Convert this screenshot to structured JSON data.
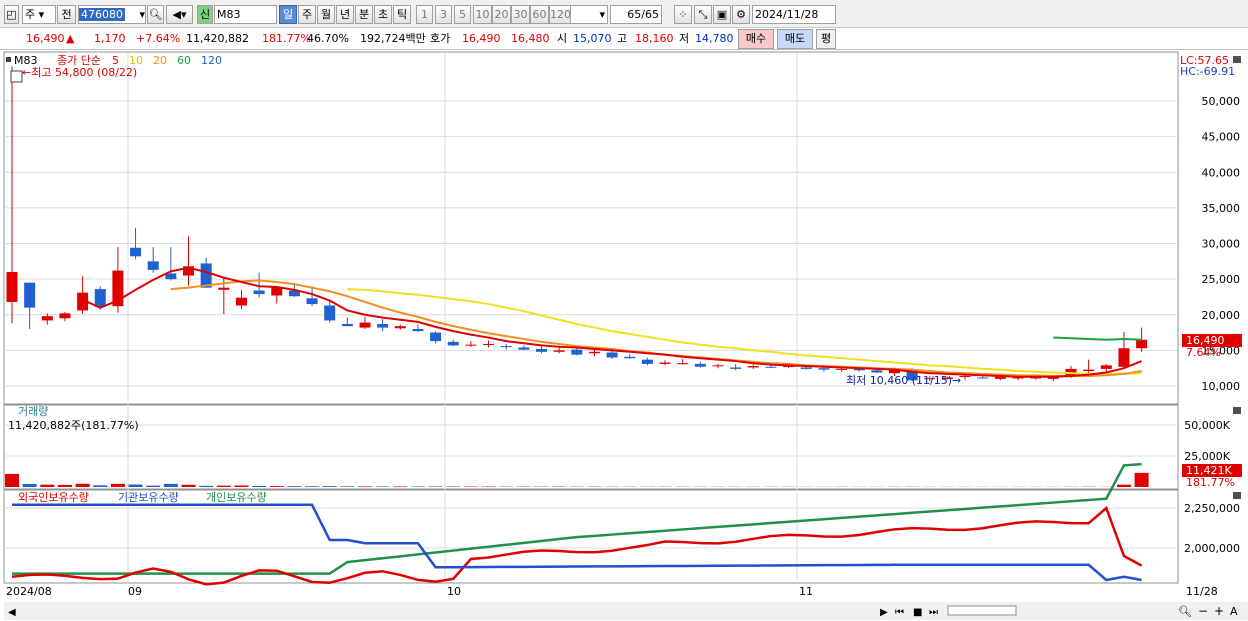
{
  "toolbar": {
    "period": "주",
    "prev": "전",
    "code": "476080",
    "badge": "신",
    "stock_name": "M83",
    "tabs": [
      "일",
      "주",
      "월",
      "년",
      "분",
      "초",
      "틱"
    ],
    "active_tab": "일",
    "minutes": [
      "1",
      "3",
      "5",
      "10",
      "20",
      "30",
      "60",
      "120"
    ],
    "count": "65",
    "total": "/65",
    "date": "2024/11/28"
  },
  "quote": {
    "price": "16,490",
    "arrow": "▲",
    "change": "1,170",
    "change_pct": "+7.64%",
    "volume": "11,420,882",
    "vol_ratio": "181.77%",
    "turnover": "46.70%",
    "amount": "192,724백만",
    "ask_label": "호가",
    "ask": "16,490",
    "bid": "16,480",
    "open_label": "시",
    "open": "15,070",
    "high_label": "고",
    "high": "18,160",
    "low_label": "저",
    "low": "14,780",
    "buy": "매수",
    "sell": "매도",
    "eval": "평"
  },
  "price_panel": {
    "name": "M83",
    "ma_label": "종가 단순",
    "ma_periods": [
      "5",
      "10",
      "20",
      "60",
      "120"
    ],
    "ma_colors": [
      "#e00000",
      "#e0c000",
      "#f09020",
      "#20a040",
      "#2060c0"
    ],
    "high_annot": "←최고 54,800 (08/22)",
    "low_annot": "최저 10,460 (11/15)→",
    "lc": "LC:57.65",
    "hc": "HC:-69.91",
    "last_price": "16,490",
    "last_pct": "7.64%",
    "yticks": [
      "50,000",
      "45,000",
      "40,000",
      "35,000",
      "30,000",
      "25,000",
      "20,000",
      "15,000",
      "10,000"
    ]
  },
  "volume_panel": {
    "title": "거래량",
    "value": "11,420,882주(181.77%)",
    "yticks": [
      "50,000K",
      "25,000K"
    ],
    "last": "11,421K",
    "last_pct": "181.77%"
  },
  "holdings_panel": {
    "foreign": "외국인보유수량",
    "inst": "기관보유수량",
    "indiv": "개인보유수량",
    "yticks": [
      "2,250,000",
      "2,000,000"
    ]
  },
  "xaxis": {
    "labels": [
      "2024/08",
      "09",
      "10",
      "11"
    ],
    "end": "11/28"
  },
  "colors": {
    "up": "#e00000",
    "down": "#2060d0"
  },
  "chart_data": {
    "type": "candlestick",
    "dates_note": "2024/08/22 - 2024/11/28, 65 trading days",
    "ohlc": [
      [
        21800,
        54800,
        18800,
        26000
      ],
      [
        24500,
        24500,
        18000,
        21000
      ],
      [
        19200,
        20200,
        18600,
        19800
      ],
      [
        19500,
        20400,
        19100,
        20200
      ],
      [
        20600,
        25400,
        20100,
        23100
      ],
      [
        23600,
        24000,
        20700,
        21100
      ],
      [
        21200,
        29500,
        20300,
        26200
      ],
      [
        29400,
        32200,
        27800,
        28200
      ],
      [
        27500,
        29500,
        25900,
        26300
      ],
      [
        25800,
        29500,
        24800,
        25000
      ],
      [
        25500,
        31000,
        24100,
        26800
      ],
      [
        27200,
        28000,
        23800,
        23800
      ],
      [
        23500,
        25200,
        20100,
        23800
      ],
      [
        21300,
        23500,
        20800,
        22400
      ],
      [
        23400,
        25900,
        22400,
        22900
      ],
      [
        22700,
        24000,
        21600,
        23900
      ],
      [
        23400,
        24500,
        22500,
        22600
      ],
      [
        22300,
        24000,
        21200,
        21500
      ],
      [
        21300,
        22000,
        18900,
        19200
      ],
      [
        18700,
        19600,
        18400,
        18400
      ],
      [
        18200,
        19700,
        18000,
        18900
      ],
      [
        18700,
        19400,
        17700,
        18200
      ],
      [
        18100,
        18600,
        17900,
        18400
      ],
      [
        18000,
        18600,
        17600,
        17700
      ],
      [
        17500,
        17700,
        16000,
        16300
      ],
      [
        16200,
        16500,
        15600,
        15700
      ],
      [
        15700,
        16300,
        15500,
        15800
      ],
      [
        15800,
        16400,
        15400,
        15900
      ],
      [
        15600,
        15900,
        15100,
        15500
      ],
      [
        15400,
        15700,
        15000,
        15100
      ],
      [
        15200,
        15600,
        14600,
        14800
      ],
      [
        14800,
        15400,
        14600,
        15000
      ],
      [
        15100,
        15500,
        14300,
        14400
      ],
      [
        14600,
        15100,
        14200,
        14800
      ],
      [
        14700,
        14900,
        13800,
        14000
      ],
      [
        14100,
        14500,
        13800,
        13900
      ],
      [
        13700,
        14000,
        12900,
        13100
      ],
      [
        13100,
        13600,
        12900,
        13300
      ],
      [
        13200,
        13800,
        13000,
        13200
      ],
      [
        13100,
        13400,
        12600,
        12700
      ],
      [
        12800,
        13100,
        12500,
        12900
      ],
      [
        12600,
        13100,
        12200,
        12400
      ],
      [
        12600,
        13000,
        12400,
        12800
      ],
      [
        12700,
        13000,
        12500,
        12600
      ],
      [
        12700,
        12900,
        12500,
        12800
      ],
      [
        12600,
        12900,
        12300,
        12400
      ],
      [
        12500,
        13000,
        12000,
        12300
      ],
      [
        12300,
        12800,
        12000,
        12400
      ],
      [
        12400,
        12700,
        12000,
        12200
      ],
      [
        12200,
        12400,
        11800,
        11900
      ],
      [
        11800,
        12600,
        11400,
        12500
      ],
      [
        12300,
        12500,
        10700,
        10800
      ],
      [
        11000,
        11400,
        10700,
        11100
      ],
      [
        11000,
        11300,
        10900,
        11200
      ],
      [
        11300,
        11700,
        10900,
        11400
      ],
      [
        11200,
        11500,
        11000,
        11100
      ],
      [
        11000,
        11400,
        10800,
        11300
      ],
      [
        11100,
        11400,
        10800,
        11200
      ],
      [
        11200,
        11500,
        10900,
        11200
      ],
      [
        11000,
        11400,
        10700,
        11300
      ],
      [
        11300,
        12800,
        11100,
        12400
      ],
      [
        12100,
        13700,
        11500,
        12300
      ],
      [
        12400,
        13100,
        11900,
        12900
      ],
      [
        12700,
        17600,
        12600,
        15300
      ],
      [
        15300,
        18200,
        14800,
        16490
      ]
    ],
    "volume_k": [
      10500,
      2400,
      1900,
      1700,
      2600,
      1300,
      2600,
      2000,
      1100,
      2500,
      1800,
      900,
      1100,
      1200,
      800,
      700,
      650,
      600,
      700,
      500,
      450,
      400,
      420,
      380,
      450,
      380,
      350,
      330,
      300,
      320,
      280,
      300,
      260,
      240,
      220,
      210,
      200,
      190,
      190,
      180,
      170,
      170,
      160,
      160,
      150,
      150,
      150,
      140,
      140,
      140,
      150,
      200,
      130,
      120,
      110,
      110,
      100,
      110,
      100,
      100,
      150,
      210,
      120,
      1900,
      11421
    ],
    "ma5": [
      null,
      null,
      null,
      null,
      22100,
      21000,
      22000,
      23500,
      24900,
      26100,
      26600,
      26000,
      25200,
      24600,
      24000,
      23900,
      23500,
      22900,
      22000,
      20600,
      20000,
      19600,
      19300,
      19000,
      18300,
      17700,
      17200,
      16800,
      16300,
      16000,
      15700,
      15500,
      15400,
      15200,
      15000,
      14800,
      14600,
      14400,
      14100,
      13900,
      13700,
      13500,
      13200,
      13000,
      12900,
      12800,
      12700,
      12600,
      12500,
      12400,
      12300,
      12000,
      11800,
      11700,
      11600,
      11500,
      11400,
      11300,
      11300,
      11300,
      11400,
      11600,
      11900,
      12500,
      13500
    ],
    "ma10": [
      null,
      null,
      null,
      null,
      null,
      null,
      null,
      null,
      null,
      23600,
      23800,
      24100,
      24400,
      24700,
      24800,
      24600,
      24300,
      23800,
      23300,
      22600,
      21800,
      21000,
      20300,
      19700,
      19000,
      18400,
      17900,
      17400,
      17000,
      16600,
      16200,
      15900,
      15600,
      15400,
      15200,
      14900,
      14700,
      14400,
      14200,
      14000,
      13800,
      13600,
      13400,
      13200,
      13100,
      12900,
      12800,
      12700,
      12600,
      12500,
      12400,
      12300,
      12100,
      11900,
      11800,
      11700,
      11600,
      11500,
      11500,
      11400,
      11400,
      11400,
      11500,
      11700,
      12100
    ],
    "ma20": [
      null,
      null,
      null,
      null,
      null,
      null,
      null,
      null,
      null,
      null,
      null,
      null,
      null,
      null,
      null,
      null,
      null,
      null,
      null,
      23600,
      23500,
      23300,
      23000,
      22800,
      22500,
      22200,
      21900,
      21500,
      21000,
      20500,
      19900,
      19300,
      18700,
      18200,
      17700,
      17300,
      16900,
      16500,
      16100,
      15800,
      15500,
      15300,
      15000,
      14800,
      14500,
      14300,
      14100,
      13900,
      13700,
      13500,
      13300,
      13100,
      12900,
      12800,
      12600,
      12400,
      12300,
      12100,
      12000,
      11900,
      11800,
      11700,
      11700,
      11700,
      11800
    ],
    "ma60_tail": [
      16800,
      16700,
      16600,
      16500,
      16600,
      16490
    ]
  }
}
